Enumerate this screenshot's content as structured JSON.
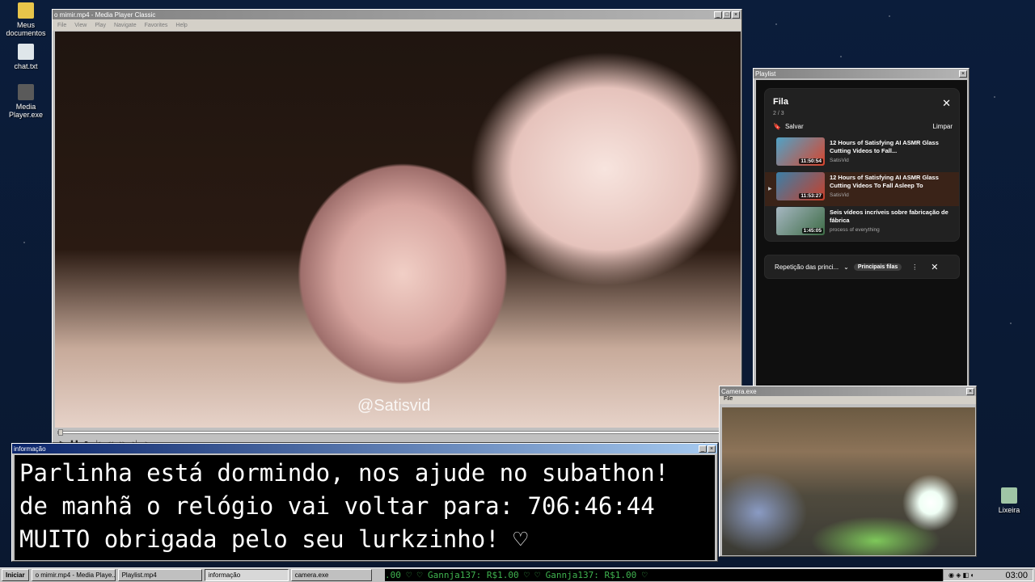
{
  "desktop": {
    "icons": [
      {
        "label": "Meus documentos",
        "color": "#e8c54a"
      },
      {
        "label": "chat.txt",
        "color": "#dfe6ea"
      },
      {
        "label": "Media Player.exe",
        "color": "#5a5a5a"
      },
      {
        "label": "Lixeira",
        "color": "#9fc5a6"
      }
    ]
  },
  "mpc": {
    "title": "o mimir.mp4 - Media Player Classic",
    "menu": [
      "File",
      "View",
      "Play",
      "Navigate",
      "Favorites",
      "Help"
    ],
    "watermark": "@Satisvid",
    "progress": 0.0
  },
  "playlist": {
    "title": "Playlist",
    "queue_title": "Fila",
    "queue_count": "2 / 3",
    "save_label": "Salvar",
    "clear_label": "Limpar",
    "items": [
      {
        "title": "12 Hours of Satisfying AI ASMR Glass Cutting Videos to Fall...",
        "channel": "SatisVid",
        "duration": "11:50:54",
        "current": false
      },
      {
        "title": "12 Hours of Satisfying AI ASMR Glass Cutting Videos To Fall Asleep To",
        "channel": "SatisVid",
        "duration": "11:53:27",
        "current": true
      },
      {
        "title": "Seis vídeos incríveis sobre fabricação de fábrica",
        "channel": "process of everything",
        "duration": "1:45:05",
        "current": false
      }
    ],
    "repeat_label": "Repetição das princi...",
    "repeat_chip": "Principais filas"
  },
  "camera": {
    "title": "Camera.exe",
    "menu_file": "File"
  },
  "info": {
    "title": "informação",
    "line1": "Parlinha está dormindo, nos ajude no subathon!",
    "line2": "de manhã o relógio vai voltar para:  706:46:44",
    "line3": "MUITO obrigada pelo seu lurkzinho! ♡"
  },
  "taskbar": {
    "start": "Iniciar",
    "tasks": [
      "o mimir.mp4 - Media Playe...",
      "Playlist.mp4",
      "informação",
      "camera.exe"
    ],
    "ticker": ".00 ♡   ♡ Gannja137: R$1.00 ♡   ♡ Gannja137: R$1.00 ♡",
    "clock": "03:00"
  }
}
